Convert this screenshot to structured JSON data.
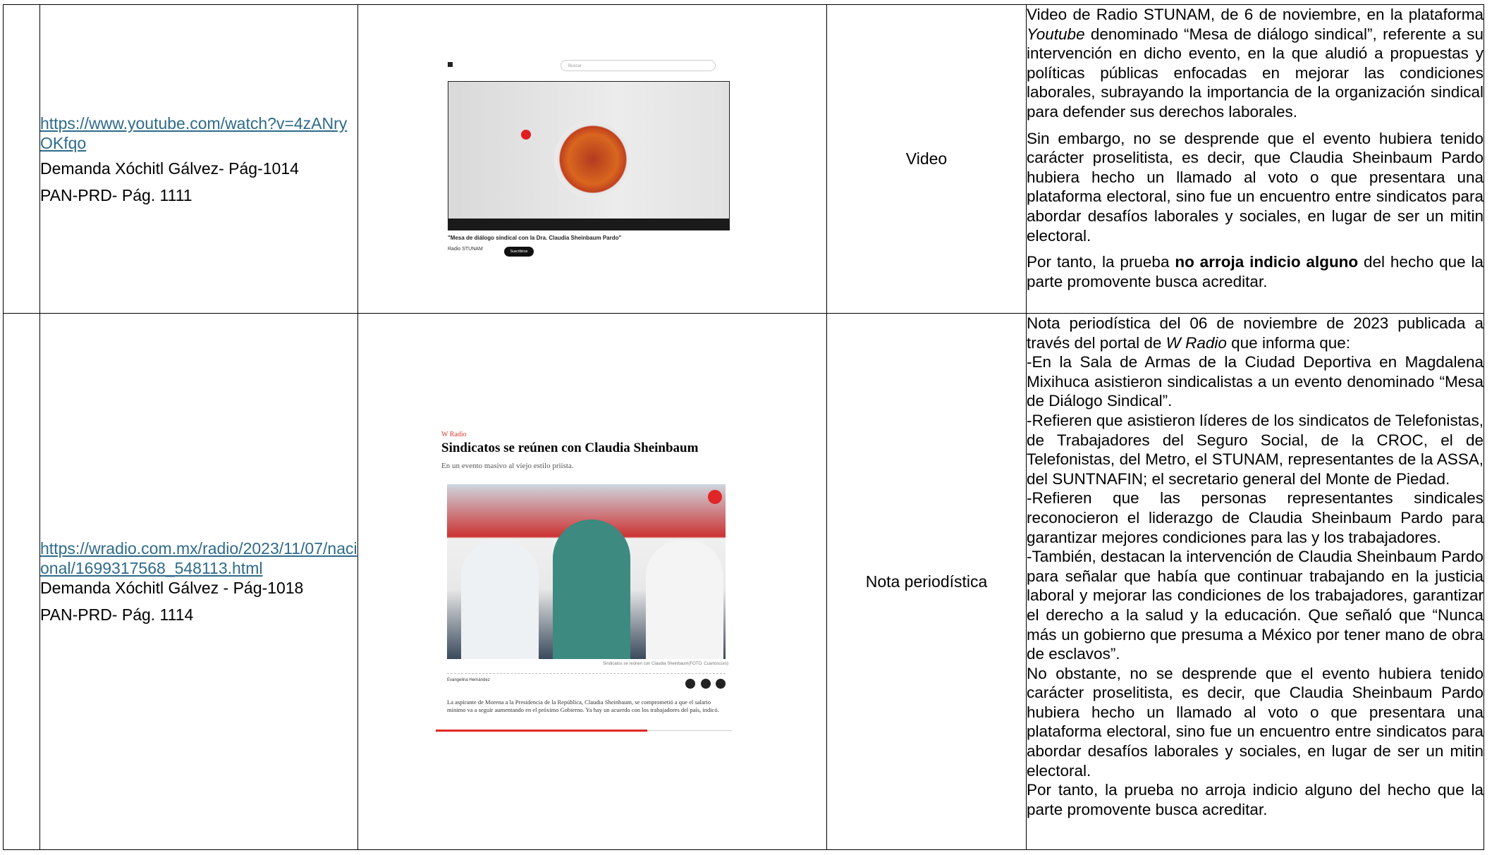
{
  "rows": [
    {
      "source_url": "https://www.youtube.com/watch?v=4zANryOKfqo",
      "demanda": "Demanda Xóchitl Gálvez- Pág-1014",
      "pan": "PAN-PRD- Pág. 1111",
      "tipo": "Video",
      "screenshot": {
        "search_placeholder": "Buscar",
        "video_title": "\"Mesa de diálogo sindical con la Dra. Claudia Sheinbaum Pardo\"",
        "channel": "Radio STUNAM",
        "subscribe": "Suscribirse"
      },
      "desc": [
        [
          {
            "t": "Video de Radio STUNAM, de 6 de noviembre, en la plataforma "
          },
          {
            "t": "Youtube",
            "i": true
          },
          {
            "t": " denominado “Mesa de diálogo sindical”, referente a su intervención en dicho evento, en la que aludió a propuestas y políticas públicas enfocadas en mejorar las condiciones laborales, subrayando la importancia de la organización sindical para defender sus derechos laborales."
          }
        ],
        [
          {
            "t": "Sin embargo, no se desprende que el evento hubiera tenido carácter proselitista, es decir, que Claudia Sheinbaum Pardo hubiera hecho un llamado al voto o que presentara una plataforma electoral, sino fue un encuentro entre sindicatos para abordar desafíos laborales y sociales, en lugar de ser un mitin electoral."
          }
        ],
        [
          {
            "t": "Por tanto, la prueba "
          },
          {
            "t": "no arroja indicio alguno",
            "b": true
          },
          {
            "t": " del hecho que la parte promovente busca acreditar."
          }
        ]
      ]
    },
    {
      "source_url": "https://wradio.com.mx/radio/2023/11/07/nacional/1699317568_548113.html",
      "demanda": "Demanda Xóchitl Gálvez - Pág-1018",
      "pan": "PAN-PRD- Pág. 1114",
      "tipo": "Nota periodística",
      "screenshot": {
        "brand": "W Radio",
        "headline": "Sindicatos se reúnen con Claudia Sheinbaum",
        "lede": "En un evento masivo al viejo estilo priista.",
        "photo_caption": "Sindicatos se reúnen con Claudia Sheinbaum(FOTO: Cuartoscuro)",
        "author": "Evangelina Hernández",
        "body": "La aspirante de Morena a la Presidencia de la República, Claudia Sheinbaum, se comprometió a que el salario mínimo va a seguir aumentando en el próximo Gobierno. Ya hay un acuerdo con los trabajadores del país, indicó."
      },
      "desc": [
        [
          {
            "t": "Nota periodística del 06 de noviembre de 2023 publicada a través del portal de "
          },
          {
            "t": "W Radio",
            "i": true
          },
          {
            "t": " que informa que:"
          }
        ],
        [
          {
            "t": "-En la Sala de Armas de la Ciudad Deportiva en Magdalena Mixihuca asistieron sindicalistas a un evento denominado “Mesa de Diálogo Sindical”."
          }
        ],
        [
          {
            "t": "-Refieren que asistieron líderes de los sindicatos de Telefonistas, de Trabajadores del Seguro Social, de la CROC, el de Telefonistas, del Metro, el STUNAM, representantes de la ASSA, del SUNTNAFIN; el secretario general del Monte de Piedad."
          }
        ],
        [
          {
            "t": "-Refieren que las personas representantes sindicales reconocieron el liderazgo de Claudia Sheinbaum Pardo para garantizar mejores condiciones para las y los trabajadores."
          }
        ],
        [
          {
            "t": "-También, destacan la intervención de Claudia Sheinbaum Pardo para señalar que había que continuar trabajando en la justicia laboral y mejorar las condiciones de los trabajadores, garantizar el derecho a la salud y la educación. Que señaló que “Nunca más un gobierno que presuma a México por tener mano de obra de esclavos”."
          }
        ],
        [
          {
            "t": "No obstante, no se desprende que el evento hubiera tenido carácter proselitista, es decir, que Claudia Sheinbaum Pardo hubiera hecho un llamado al voto o que presentara una plataforma electoral, sino fue un encuentro entre sindicatos para abordar desafíos laborales y sociales, en lugar de ser un mitin electoral."
          }
        ],
        [
          {
            "t": "Por tanto, la prueba no arroja indicio alguno del hecho que la parte promovente busca acreditar."
          }
        ]
      ]
    }
  ]
}
